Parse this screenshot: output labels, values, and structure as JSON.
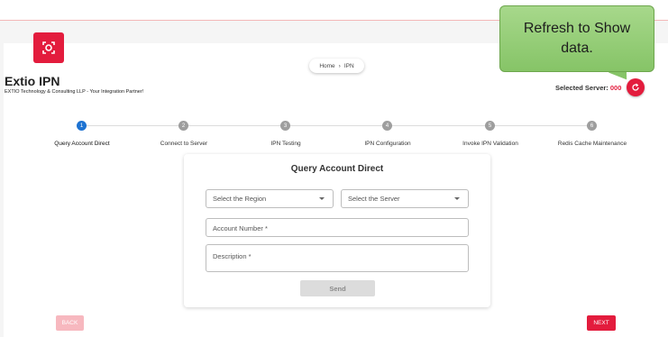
{
  "app": {
    "title": "Extio IPN",
    "subtitle": "EXTIO Technology & Consulting LLP - Your Integration Partner!",
    "logo_icon": "camera-target-icon"
  },
  "breadcrumb": {
    "home": "Home",
    "separator": "›",
    "current": "IPN"
  },
  "server": {
    "label": "Selected Server:",
    "value": "000",
    "refresh_icon": "refresh-icon"
  },
  "callout": {
    "text": "Refresh to Show data."
  },
  "stepper": {
    "active_index": 0,
    "steps": [
      {
        "number": "1",
        "label": "Query Account Direct"
      },
      {
        "number": "2",
        "label": "Connect to Server"
      },
      {
        "number": "3",
        "label": "IPN Testing"
      },
      {
        "number": "4",
        "label": "IPN Configuration"
      },
      {
        "number": "5",
        "label": "Invoke IPN Validation"
      },
      {
        "number": "6",
        "label": "Redis Cache Maintenance"
      }
    ]
  },
  "form": {
    "title": "Query Account Direct",
    "region_select": "Select the Region",
    "server_select": "Select the Server",
    "account_placeholder": "Account Number *",
    "description_placeholder": "Description *",
    "send_label": "Send"
  },
  "nav": {
    "back_label": "BACK",
    "next_label": "NEXT"
  },
  "colors": {
    "accent": "#e31c3d",
    "step_active": "#1e73d2",
    "step_inactive": "#9e9e9e",
    "callout_fill": "#92cc74"
  }
}
